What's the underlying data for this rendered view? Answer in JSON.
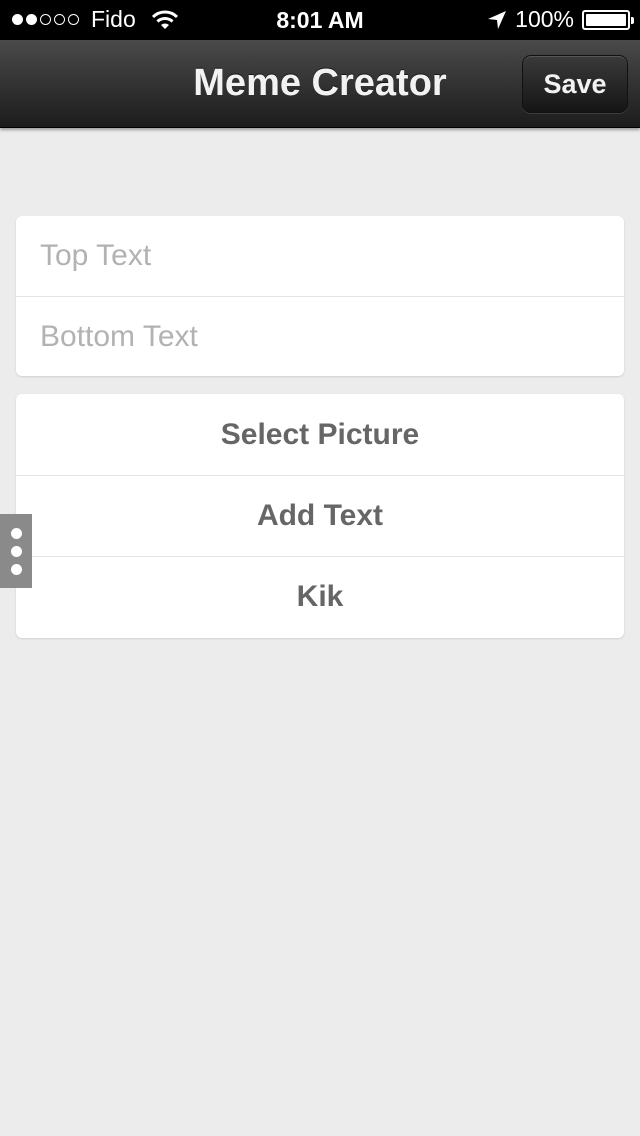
{
  "status_bar": {
    "carrier": "Fido",
    "signal_bars_filled": 2,
    "signal_bars_total": 5,
    "time": "8:01 AM",
    "battery": "100%",
    "icons": [
      "wifi-icon",
      "location-arrow-icon",
      "battery-icon"
    ]
  },
  "nav": {
    "title": "Meme Creator",
    "save_label": "Save"
  },
  "form": {
    "top_text_placeholder": "Top Text",
    "bottom_text_placeholder": "Bottom Text",
    "top_text_value": "",
    "bottom_text_value": ""
  },
  "actions": {
    "select_picture": "Select Picture",
    "add_text": "Add Text",
    "kik": "Kik"
  },
  "side_handle": {
    "icon": "vertical-ellipsis-icon"
  },
  "colors": {
    "background": "#ececec",
    "nav_bar": "#2a2a2a",
    "action_text": "#666666",
    "placeholder": "#b2b2b2"
  }
}
